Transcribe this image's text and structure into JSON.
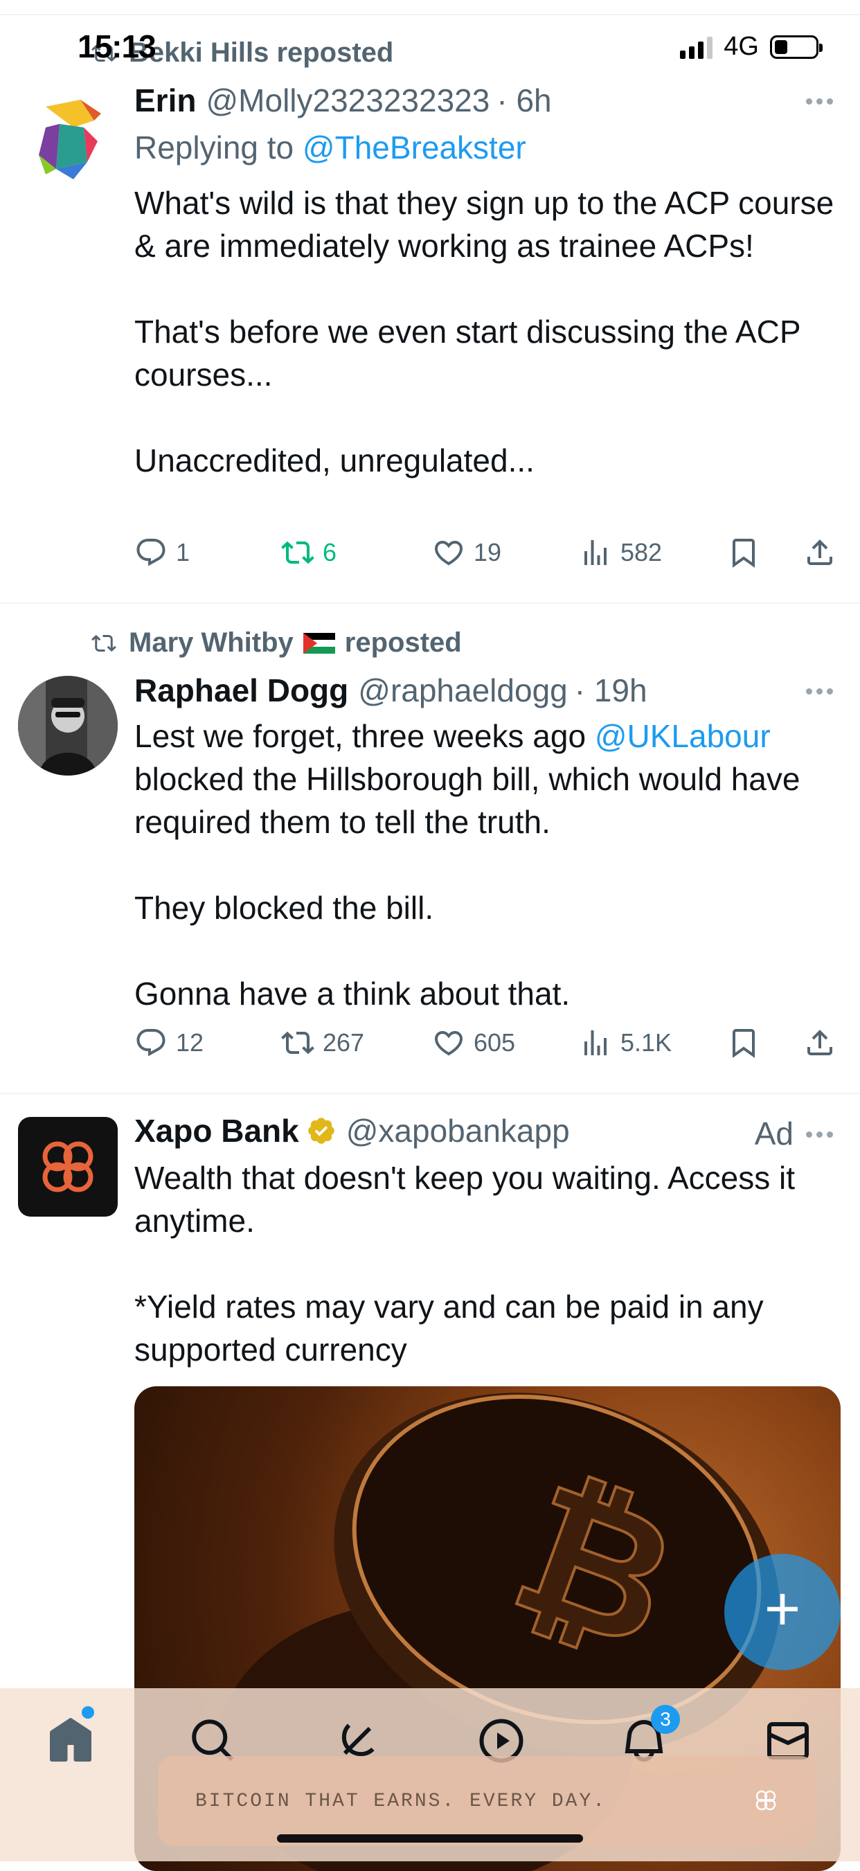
{
  "status_bar": {
    "time": "15:13",
    "network": "4G"
  },
  "tweets": [
    {
      "social_context": "Bekki Hills reposted",
      "name": "Erin",
      "handle": "@Molly2323232323",
      "time": "· 6h",
      "replying_prefix": "Replying to",
      "replying_to": "@TheBreakster",
      "paragraphs": [
        "What's wild is that they sign up to the ACP course & are immediately working as trainee ACPs!",
        "That's before we even start discussing the ACP courses...",
        "Unaccredited, unregulated..."
      ],
      "replies": "1",
      "reposts": "6",
      "likes": "19",
      "views": "582",
      "reposted_by_me": true
    },
    {
      "social_context_name": "Mary Whitby",
      "social_context_suffix": "reposted",
      "name": "Raphael Dogg",
      "handle": "@raphaeldogg",
      "time": "· 19h",
      "paragraph1_prefix": "Lest we forget, three weeks ago ",
      "paragraph1_mention": "@UKLabour",
      "paragraph1_suffix": " blocked the Hillsborough bill, which would have required them to tell the truth.",
      "paragraphs": [
        "They blocked the bill.",
        "Gonna have a think about that."
      ],
      "replies": "12",
      "reposts": "267",
      "likes": "605",
      "views": "5.1K"
    },
    {
      "name": "Xapo Bank",
      "handle": "@xapobankapp",
      "ad_label": "Ad",
      "paragraphs": [
        "Wealth that doesn't keep you waiting. Access it anytime.",
        "*Yield rates may vary and can be paid in any supported currency"
      ]
    }
  ],
  "bottom_nav": {
    "items": [
      "home-icon",
      "search-icon",
      "grok-icon",
      "video-icon",
      "notifications-icon",
      "messages-icon"
    ],
    "notifications_count": "3",
    "banner_text": "BITCOIN THAT EARNS. EVERY DAY."
  },
  "colors": {
    "accent": "#1d9bf0",
    "repost_green": "#00ba7c",
    "secondary_text": "#536471"
  }
}
